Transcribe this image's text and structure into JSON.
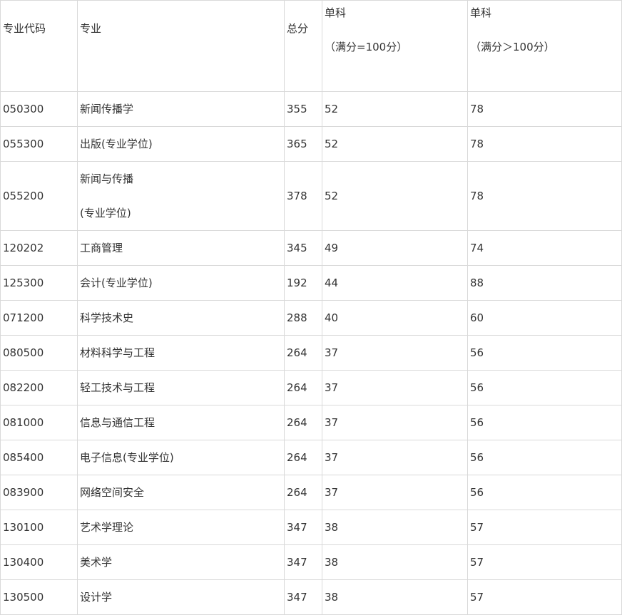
{
  "table": {
    "headers": {
      "code": "专业代码",
      "major": "专业",
      "total": "总分",
      "single_low_title": "单科",
      "single_low_sub": "（满分=100分）",
      "single_high_title": "单科",
      "single_high_sub": "（满分＞100分）"
    },
    "rows": [
      {
        "code": "050300",
        "major": "新闻传播学",
        "total": "355",
        "single_low": "52",
        "single_high": "78"
      },
      {
        "code": "055300",
        "major": "出版(专业学位)",
        "total": "365",
        "single_low": "52",
        "single_high": "78"
      },
      {
        "code": "055200",
        "major_line1": "新闻与传播",
        "major_line2": "(专业学位)",
        "total": "378",
        "single_low": "52",
        "single_high": "78"
      },
      {
        "code": "120202",
        "major": "工商管理",
        "total": "345",
        "single_low": "49",
        "single_high": "74"
      },
      {
        "code": "125300",
        "major": "会计(专业学位)",
        "total": "192",
        "single_low": "44",
        "single_high": "88"
      },
      {
        "code": "071200",
        "major": "科学技术史",
        "total": "288",
        "single_low": "40",
        "single_high": "60"
      },
      {
        "code": "080500",
        "major": "材料科学与工程",
        "total": "264",
        "single_low": "37",
        "single_high": "56"
      },
      {
        "code": "082200",
        "major": "轻工技术与工程",
        "total": "264",
        "single_low": "37",
        "single_high": "56"
      },
      {
        "code": "081000",
        "major": "信息与通信工程",
        "total": "264",
        "single_low": "37",
        "single_high": "56"
      },
      {
        "code": "085400",
        "major": "电子信息(专业学位)",
        "total": "264",
        "single_low": "37",
        "single_high": "56"
      },
      {
        "code": "083900",
        "major": "网络空间安全",
        "total": "264",
        "single_low": "37",
        "single_high": "56"
      },
      {
        "code": "130100",
        "major": "艺术学理论",
        "total": "347",
        "single_low": "38",
        "single_high": "57"
      },
      {
        "code": "130400",
        "major": "美术学",
        "total": "347",
        "single_low": "38",
        "single_high": "57"
      },
      {
        "code": "130500",
        "major": "设计学",
        "total": "347",
        "single_low": "38",
        "single_high": "57"
      }
    ]
  }
}
